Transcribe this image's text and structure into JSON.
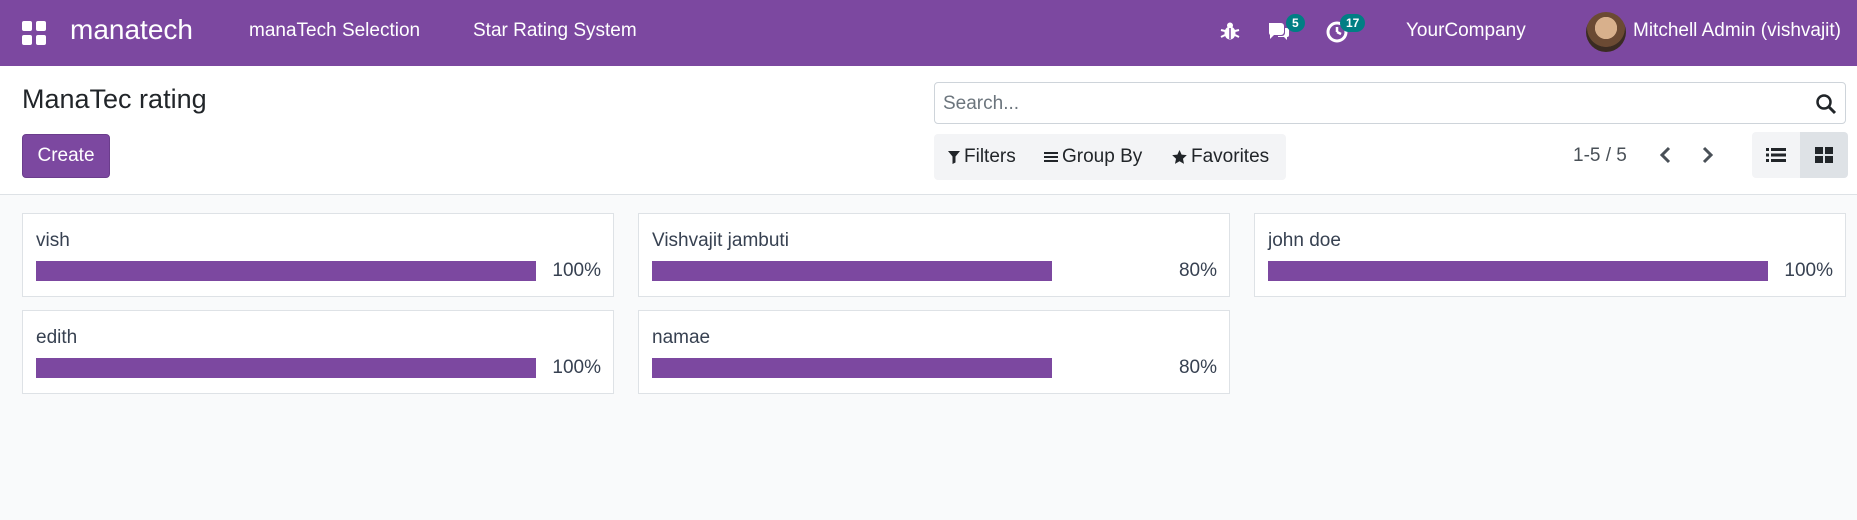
{
  "navbar": {
    "brand": "manatech",
    "menu": [
      "manaTech Selection",
      "Star Rating System"
    ],
    "messages_count": "5",
    "activities_count": "17",
    "company": "YourCompany",
    "user": "Mitchell Admin (vishvajit)",
    "accent_color": "#7c48a0",
    "badge_color": "#017e84"
  },
  "control": {
    "title": "ManaTec rating",
    "create_label": "Create",
    "search_placeholder": "Search...",
    "filters_label": "Filters",
    "groupby_label": "Group By",
    "favorites_label": "Favorites",
    "pager": "1-5 / 5"
  },
  "records": [
    {
      "name": "vish",
      "pct_label": "100%",
      "value": 100
    },
    {
      "name": "Vishvajit jambuti",
      "pct_label": "80%",
      "value": 80
    },
    {
      "name": "john doe",
      "pct_label": "100%",
      "value": 100
    },
    {
      "name": "edith",
      "pct_label": "100%",
      "value": 100
    },
    {
      "name": "namae",
      "pct_label": "80%",
      "value": 80
    }
  ]
}
